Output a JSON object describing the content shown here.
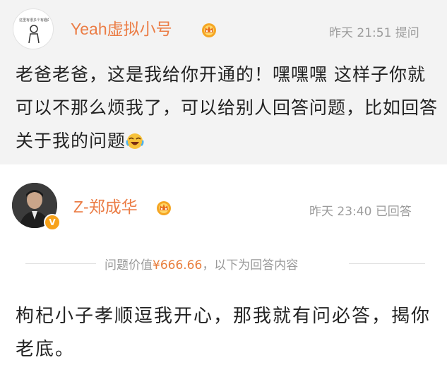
{
  "question": {
    "user_name": "Yeah虚拟小号",
    "avatar_caption": "这里有很多个有趣的图片",
    "time": "昨天 21:51",
    "action": "提问",
    "text": "老爸老爸，这是我给你开通的！嘿嘿嘿 这样子你就可以不那么烦我了，可以给别人回答问题，比如回答关于我的问题",
    "emoji_icon": "laughing-crying-emoji"
  },
  "answer": {
    "user_name": "Z-郑成华",
    "time": "昨天 23:40",
    "action": "已回答",
    "value_label": "问题价值",
    "value_amount": "¥666.66",
    "value_suffix": "，以下为回答内容",
    "text": "枸杞小子孝顺逗我开心，那我就有问必答，揭你老底。"
  },
  "colors": {
    "name": "#eb7d46",
    "amount": "#e87e3c",
    "question_bg": "#f3f3f3"
  }
}
